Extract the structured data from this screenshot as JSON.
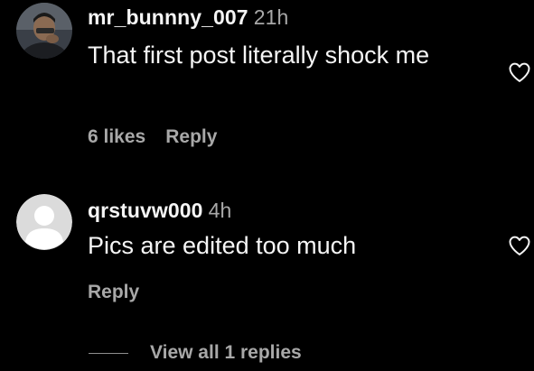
{
  "comments": [
    {
      "username": "mr_bunnny_007",
      "time": "21h",
      "text": "That first post literally shock me",
      "likes": "6 likes",
      "reply_label": "Reply",
      "avatar_icon": "profile-photo",
      "like_icon": "heart-outline-icon"
    },
    {
      "username": "qrstuvw000",
      "time": "4h",
      "text": "Pics are edited too much",
      "reply_label": "Reply",
      "avatar_icon": "default-avatar-icon",
      "like_icon": "heart-outline-icon"
    }
  ],
  "view_replies_label": "View all 1 replies",
  "colors": {
    "background": "#000000",
    "primary_text": "#f5f5f5",
    "secondary_text": "#a8a8a8",
    "default_avatar_bg": "#dbdbdb",
    "default_avatar_fg": "#ffffff"
  }
}
